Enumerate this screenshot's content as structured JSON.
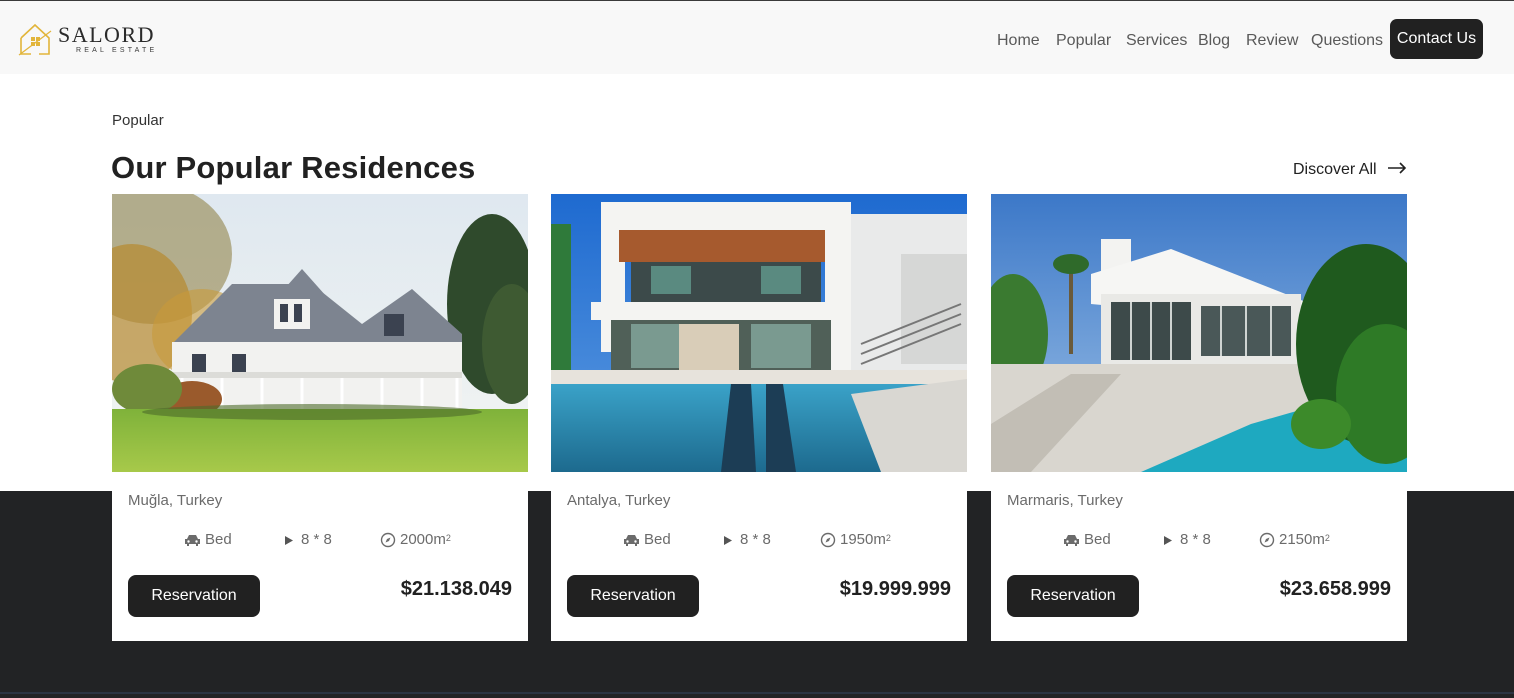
{
  "brand": {
    "name": "SALORD",
    "tagline": "REAL ESTATE",
    "accent": "#e2b53a"
  },
  "nav": {
    "links": [
      "Home",
      "Popular",
      "Services",
      "Blog",
      "Review",
      "Questions"
    ],
    "cta": "Contact Us"
  },
  "section": {
    "label": "Popular",
    "title": "Our Popular Residences",
    "discover": "Discover All"
  },
  "listings": [
    {
      "location": "Muğla, Turkey",
      "bed": "Bed",
      "rooms": "8 * 8",
      "area": "2000m",
      "area_sup": "2",
      "button": "Reservation",
      "price": "$21.138.049"
    },
    {
      "location": "Antalya, Turkey",
      "bed": "Bed",
      "rooms": "8 * 8",
      "area": "1950m",
      "area_sup": "2",
      "button": "Reservation",
      "price": "$19.999.999"
    },
    {
      "location": "Marmaris, Turkey",
      "bed": "Bed",
      "rooms": "8 * 8",
      "area": "2150m",
      "area_sup": "2",
      "button": "Reservation",
      "price": "$23.658.999"
    }
  ],
  "colors": {
    "dark": "#212121",
    "band": "#222325",
    "nav_bg": "#f8f8f8"
  }
}
